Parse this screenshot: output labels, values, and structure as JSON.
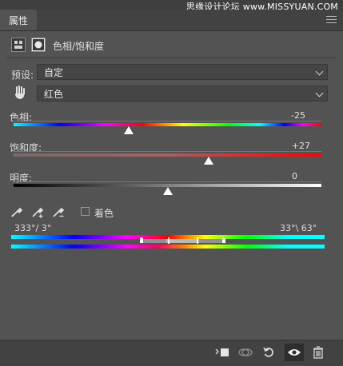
{
  "panel": {
    "tab_label": "属性",
    "watermark": "思缘设计论坛 www.MISSYUAN.COM",
    "adjustment_title": "色相/饱和度"
  },
  "preset": {
    "label": "预设:",
    "value": "自定"
  },
  "channel": {
    "value": "红色"
  },
  "sliders": [
    {
      "label": "色相:",
      "value": "-25",
      "level_fraction": 0.375
    },
    {
      "label": "饱和度:",
      "value": "+27",
      "level_fraction": 0.635
    },
    {
      "label": "明度:",
      "value": "0",
      "level_fraction": 0.5
    }
  ],
  "colorize": {
    "label": "着色",
    "checked": false
  },
  "range": {
    "left_readout": "333°/ 3°",
    "right_readout": "33°\\ 63°"
  },
  "icons": {
    "header": [
      "adjustment-layer-icon",
      "mask-icon"
    ],
    "eyedroppers": [
      "eyedropper-icon",
      "eyedropper-plus-icon",
      "eyedropper-minus-icon"
    ],
    "footer": [
      "clip-to-layer-icon",
      "view-previous-state-icon",
      "reset-icon",
      "visibility-eye-icon",
      "delete-icon"
    ]
  },
  "colors": {
    "panel_bg": "#535353",
    "accent_white": "#ffffff"
  }
}
